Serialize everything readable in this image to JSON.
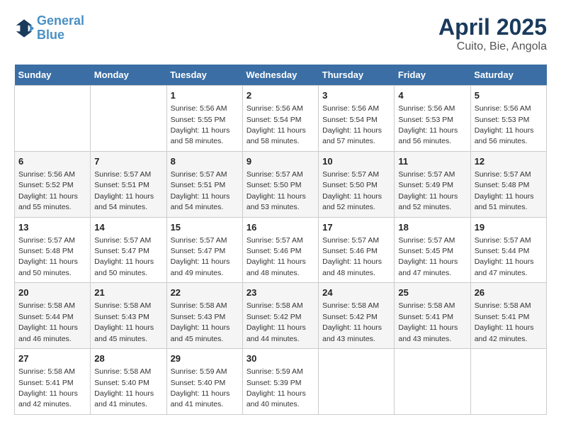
{
  "logo": {
    "line1": "General",
    "line2": "Blue"
  },
  "title": "April 2025",
  "subtitle": "Cuito, Bie, Angola",
  "days_of_week": [
    "Sunday",
    "Monday",
    "Tuesday",
    "Wednesday",
    "Thursday",
    "Friday",
    "Saturday"
  ],
  "weeks": [
    [
      {
        "day": "",
        "sunrise": "",
        "sunset": "",
        "daylight": ""
      },
      {
        "day": "",
        "sunrise": "",
        "sunset": "",
        "daylight": ""
      },
      {
        "day": "1",
        "sunrise": "Sunrise: 5:56 AM",
        "sunset": "Sunset: 5:55 PM",
        "daylight": "Daylight: 11 hours and 58 minutes."
      },
      {
        "day": "2",
        "sunrise": "Sunrise: 5:56 AM",
        "sunset": "Sunset: 5:54 PM",
        "daylight": "Daylight: 11 hours and 58 minutes."
      },
      {
        "day": "3",
        "sunrise": "Sunrise: 5:56 AM",
        "sunset": "Sunset: 5:54 PM",
        "daylight": "Daylight: 11 hours and 57 minutes."
      },
      {
        "day": "4",
        "sunrise": "Sunrise: 5:56 AM",
        "sunset": "Sunset: 5:53 PM",
        "daylight": "Daylight: 11 hours and 56 minutes."
      },
      {
        "day": "5",
        "sunrise": "Sunrise: 5:56 AM",
        "sunset": "Sunset: 5:53 PM",
        "daylight": "Daylight: 11 hours and 56 minutes."
      }
    ],
    [
      {
        "day": "6",
        "sunrise": "Sunrise: 5:56 AM",
        "sunset": "Sunset: 5:52 PM",
        "daylight": "Daylight: 11 hours and 55 minutes."
      },
      {
        "day": "7",
        "sunrise": "Sunrise: 5:57 AM",
        "sunset": "Sunset: 5:51 PM",
        "daylight": "Daylight: 11 hours and 54 minutes."
      },
      {
        "day": "8",
        "sunrise": "Sunrise: 5:57 AM",
        "sunset": "Sunset: 5:51 PM",
        "daylight": "Daylight: 11 hours and 54 minutes."
      },
      {
        "day": "9",
        "sunrise": "Sunrise: 5:57 AM",
        "sunset": "Sunset: 5:50 PM",
        "daylight": "Daylight: 11 hours and 53 minutes."
      },
      {
        "day": "10",
        "sunrise": "Sunrise: 5:57 AM",
        "sunset": "Sunset: 5:50 PM",
        "daylight": "Daylight: 11 hours and 52 minutes."
      },
      {
        "day": "11",
        "sunrise": "Sunrise: 5:57 AM",
        "sunset": "Sunset: 5:49 PM",
        "daylight": "Daylight: 11 hours and 52 minutes."
      },
      {
        "day": "12",
        "sunrise": "Sunrise: 5:57 AM",
        "sunset": "Sunset: 5:48 PM",
        "daylight": "Daylight: 11 hours and 51 minutes."
      }
    ],
    [
      {
        "day": "13",
        "sunrise": "Sunrise: 5:57 AM",
        "sunset": "Sunset: 5:48 PM",
        "daylight": "Daylight: 11 hours and 50 minutes."
      },
      {
        "day": "14",
        "sunrise": "Sunrise: 5:57 AM",
        "sunset": "Sunset: 5:47 PM",
        "daylight": "Daylight: 11 hours and 50 minutes."
      },
      {
        "day": "15",
        "sunrise": "Sunrise: 5:57 AM",
        "sunset": "Sunset: 5:47 PM",
        "daylight": "Daylight: 11 hours and 49 minutes."
      },
      {
        "day": "16",
        "sunrise": "Sunrise: 5:57 AM",
        "sunset": "Sunset: 5:46 PM",
        "daylight": "Daylight: 11 hours and 48 minutes."
      },
      {
        "day": "17",
        "sunrise": "Sunrise: 5:57 AM",
        "sunset": "Sunset: 5:46 PM",
        "daylight": "Daylight: 11 hours and 48 minutes."
      },
      {
        "day": "18",
        "sunrise": "Sunrise: 5:57 AM",
        "sunset": "Sunset: 5:45 PM",
        "daylight": "Daylight: 11 hours and 47 minutes."
      },
      {
        "day": "19",
        "sunrise": "Sunrise: 5:57 AM",
        "sunset": "Sunset: 5:44 PM",
        "daylight": "Daylight: 11 hours and 47 minutes."
      }
    ],
    [
      {
        "day": "20",
        "sunrise": "Sunrise: 5:58 AM",
        "sunset": "Sunset: 5:44 PM",
        "daylight": "Daylight: 11 hours and 46 minutes."
      },
      {
        "day": "21",
        "sunrise": "Sunrise: 5:58 AM",
        "sunset": "Sunset: 5:43 PM",
        "daylight": "Daylight: 11 hours and 45 minutes."
      },
      {
        "day": "22",
        "sunrise": "Sunrise: 5:58 AM",
        "sunset": "Sunset: 5:43 PM",
        "daylight": "Daylight: 11 hours and 45 minutes."
      },
      {
        "day": "23",
        "sunrise": "Sunrise: 5:58 AM",
        "sunset": "Sunset: 5:42 PM",
        "daylight": "Daylight: 11 hours and 44 minutes."
      },
      {
        "day": "24",
        "sunrise": "Sunrise: 5:58 AM",
        "sunset": "Sunset: 5:42 PM",
        "daylight": "Daylight: 11 hours and 43 minutes."
      },
      {
        "day": "25",
        "sunrise": "Sunrise: 5:58 AM",
        "sunset": "Sunset: 5:41 PM",
        "daylight": "Daylight: 11 hours and 43 minutes."
      },
      {
        "day": "26",
        "sunrise": "Sunrise: 5:58 AM",
        "sunset": "Sunset: 5:41 PM",
        "daylight": "Daylight: 11 hours and 42 minutes."
      }
    ],
    [
      {
        "day": "27",
        "sunrise": "Sunrise: 5:58 AM",
        "sunset": "Sunset: 5:41 PM",
        "daylight": "Daylight: 11 hours and 42 minutes."
      },
      {
        "day": "28",
        "sunrise": "Sunrise: 5:58 AM",
        "sunset": "Sunset: 5:40 PM",
        "daylight": "Daylight: 11 hours and 41 minutes."
      },
      {
        "day": "29",
        "sunrise": "Sunrise: 5:59 AM",
        "sunset": "Sunset: 5:40 PM",
        "daylight": "Daylight: 11 hours and 41 minutes."
      },
      {
        "day": "30",
        "sunrise": "Sunrise: 5:59 AM",
        "sunset": "Sunset: 5:39 PM",
        "daylight": "Daylight: 11 hours and 40 minutes."
      },
      {
        "day": "",
        "sunrise": "",
        "sunset": "",
        "daylight": ""
      },
      {
        "day": "",
        "sunrise": "",
        "sunset": "",
        "daylight": ""
      },
      {
        "day": "",
        "sunrise": "",
        "sunset": "",
        "daylight": ""
      }
    ]
  ]
}
